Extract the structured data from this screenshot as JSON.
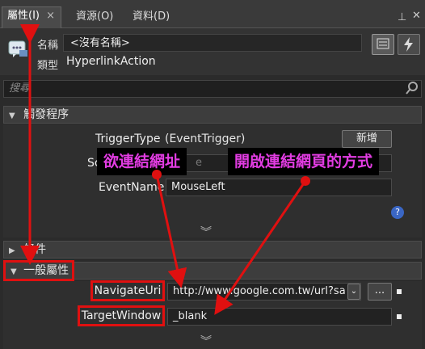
{
  "tabs": [
    {
      "label": "屬性(I)",
      "close": "×"
    },
    {
      "label": "資源(O)"
    },
    {
      "label": "資料(D)"
    }
  ],
  "header": {
    "name_label": "名稱",
    "name_value": "<沒有名稱>",
    "type_label": "類型",
    "type_value": "HyperlinkAction"
  },
  "search": {
    "placeholder": "搜尋"
  },
  "sections": {
    "triggers": {
      "title": "觸發程序",
      "trigger_type_label": "TriggerType",
      "trigger_type_value": "(EventTrigger)",
      "new_button": "新增",
      "source_label": "Sc",
      "source_value": "e",
      "event_name_label": "EventName",
      "event_name_value": "MouseLeft"
    },
    "conditions": {
      "title": "條件"
    },
    "common": {
      "title": "一般屬性",
      "navigate_label": "NavigateUri",
      "navigate_value": "http://www.google.com.tw/url?sa",
      "ellipsis": "...",
      "target_label": "TargetWindow",
      "target_value": "_blank"
    }
  },
  "annotations": {
    "url_callout": "欲連結網址",
    "target_callout": "開啟連結網頁的方式"
  },
  "colors": {
    "highlight": "#e01010",
    "callout_text": "#e23ce2"
  }
}
